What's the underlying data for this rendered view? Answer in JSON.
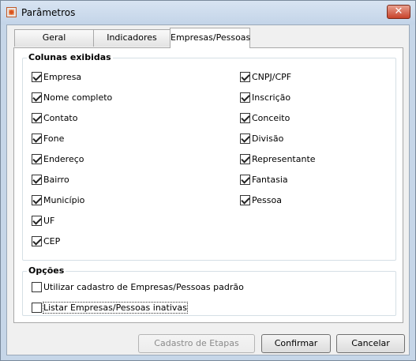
{
  "window": {
    "title": "Parâmetros",
    "close_glyph": "✕"
  },
  "tabs": [
    {
      "label": "Geral",
      "active": false
    },
    {
      "label": "Indicadores",
      "active": false
    },
    {
      "label": "Empresas/Pessoas",
      "active": true
    }
  ],
  "columns_group": {
    "title": "Colunas exibidas",
    "left": [
      {
        "label": "Empresa",
        "checked": true
      },
      {
        "label": "Nome completo",
        "checked": true
      },
      {
        "label": "Contato",
        "checked": true
      },
      {
        "label": "Fone",
        "checked": true
      },
      {
        "label": "Endereço",
        "checked": true
      },
      {
        "label": "Bairro",
        "checked": true
      },
      {
        "label": "Município",
        "checked": true
      },
      {
        "label": "UF",
        "checked": true
      },
      {
        "label": "CEP",
        "checked": true
      }
    ],
    "right": [
      {
        "label": "CNPJ/CPF",
        "checked": true
      },
      {
        "label": "Inscrição",
        "checked": true
      },
      {
        "label": "Conceito",
        "checked": true
      },
      {
        "label": "Divisão",
        "checked": true
      },
      {
        "label": "Representante",
        "checked": true
      },
      {
        "label": "Fantasia",
        "checked": true
      },
      {
        "label": "Pessoa",
        "checked": true
      }
    ]
  },
  "options_group": {
    "title": "Opções",
    "items": [
      {
        "label": "Utilizar cadastro de Empresas/Pessoas padrão",
        "checked": false
      },
      {
        "label": "Listar Empresas/Pessoas inativas",
        "checked": false
      }
    ]
  },
  "buttons": {
    "stages": "Cadastro de Etapas",
    "confirm": "Confirmar",
    "cancel": "Cancelar"
  }
}
